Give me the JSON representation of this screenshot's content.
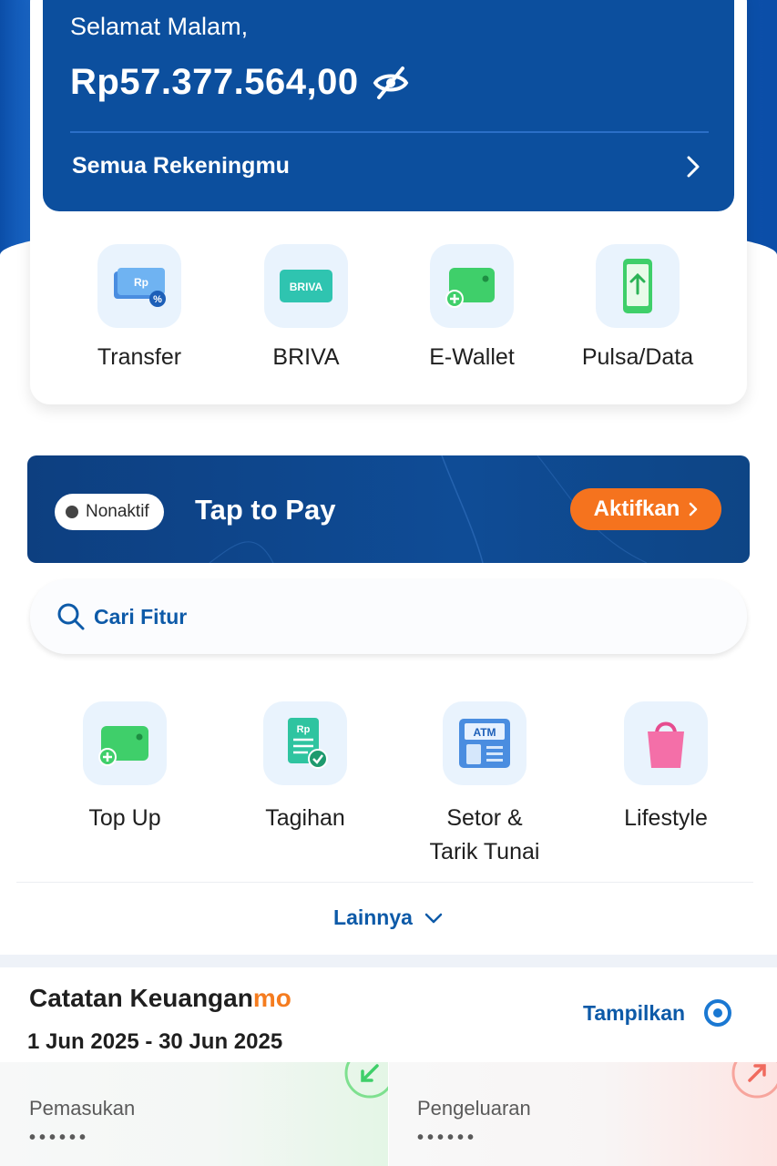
{
  "header": {
    "greeting": "Selamat Malam,",
    "balance": "Rp57.377.564,00",
    "accounts_link": "Semua Rekeningmu"
  },
  "quick_actions": [
    {
      "label": "Transfer",
      "icon": "transfer-icon"
    },
    {
      "label": "BRIVA",
      "icon": "briva-icon",
      "badge": "BRIVA"
    },
    {
      "label": "E-Wallet",
      "icon": "wallet-icon"
    },
    {
      "label": "Pulsa/Data",
      "icon": "phone-icon"
    }
  ],
  "tap_to_pay": {
    "status": "Nonaktif",
    "title": "Tap to Pay",
    "button": "Aktifkan"
  },
  "search": {
    "placeholder": "Cari Fitur"
  },
  "features": [
    {
      "label": "Top Up",
      "icon": "wallet-icon"
    },
    {
      "label": "Tagihan",
      "icon": "bill-icon"
    },
    {
      "label_line1": "Setor &",
      "label_line2": "Tarik Tunai",
      "icon": "atm-icon",
      "atm_text": "ATM"
    },
    {
      "label": "Lifestyle",
      "icon": "shopping-bag-icon"
    }
  ],
  "more": {
    "label": "Lainnya"
  },
  "finance": {
    "title": "Catatan Keuangan",
    "title_suffix": "mo",
    "date_range": "1 Jun 2025 - 30 Jun 2025",
    "show_label": "Tampilkan",
    "income_label": "Pemasukan",
    "income_value": "••••••",
    "expense_label": "Pengeluaran",
    "expense_value": "••••••"
  },
  "colors": {
    "primary": "#0c4f9e",
    "accent_orange": "#f5731e",
    "link_blue": "#0d5aa8"
  }
}
